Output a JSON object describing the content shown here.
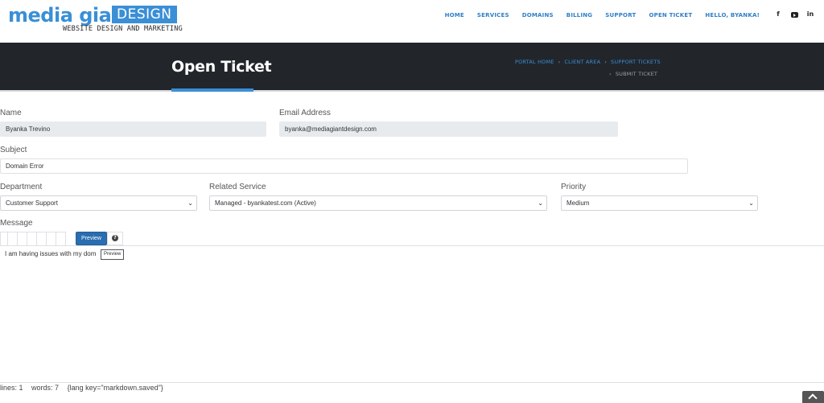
{
  "logo": {
    "main": "media giant",
    "box": "DESIGN",
    "tagline": "WEBSITE DESIGN AND MARKETING"
  },
  "nav": [
    "HOME",
    "SERVICES",
    "DOMAINS",
    "BILLING",
    "SUPPORT",
    "OPEN TICKET",
    "HELLO, BYANKA!"
  ],
  "social": {
    "facebook": "f",
    "linkedin": "in"
  },
  "banner": {
    "title": "Open Ticket",
    "breadcrumb": [
      "PORTAL HOME",
      "CLIENT AREA",
      "SUPPORT TICKETS"
    ],
    "breadcrumb_separator": "›",
    "current": "SUBMIT TICKET"
  },
  "form": {
    "name_label": "Name",
    "name_value": "Byanka Trevino",
    "email_label": "Email Address",
    "email_value": "byanka@mediagiantdesign.com",
    "subject_label": "Subject",
    "subject_value": "Domain Error",
    "department_label": "Department",
    "department_value": "Customer Support",
    "service_label": "Related Service",
    "service_value": "Managed - byankatest.com (Active)",
    "priority_label": "Priority",
    "priority_value": "Medium",
    "message_label": "Message"
  },
  "editor": {
    "preview_label": "Preview",
    "help_glyph": "?",
    "text": "I am having issues with my dom",
    "tooltip": "Preview",
    "status_lines": "lines: 1",
    "status_words": "words: 7",
    "status_saved": "{lang key=\"markdown.saved\"}"
  },
  "colors": {
    "accent": "#3a8fd6",
    "banner_bg": "#22262b",
    "button": "#2a6db0"
  }
}
